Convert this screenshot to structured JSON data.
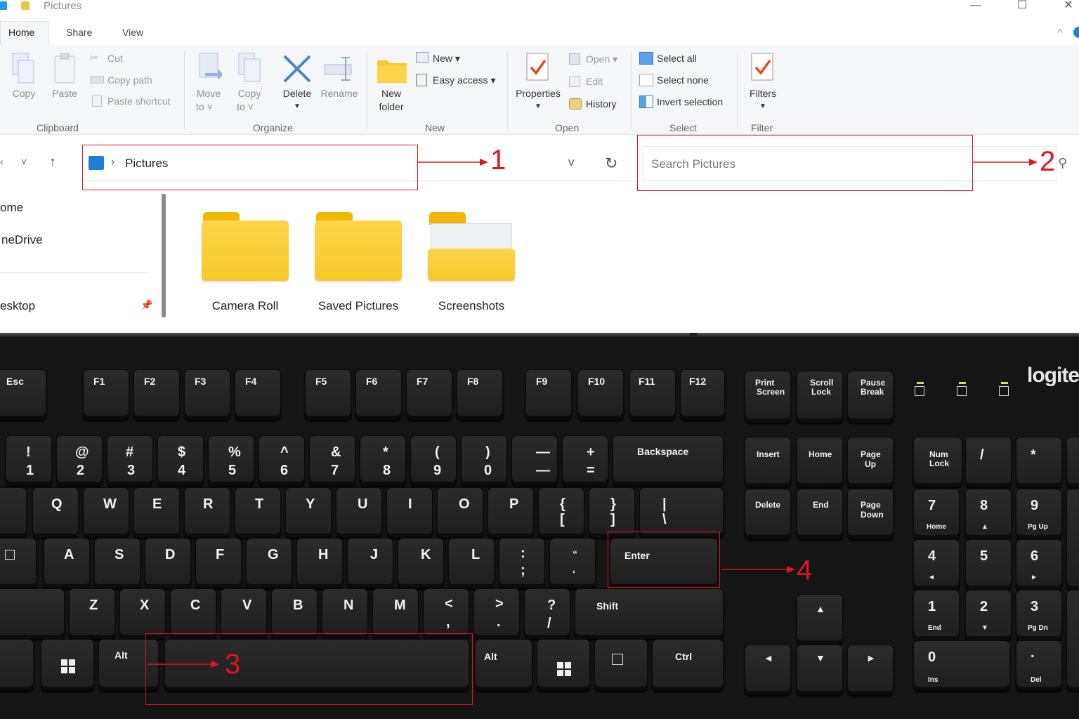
{
  "window": {
    "title": "Pictures",
    "minimize": "—",
    "maximize": "☐",
    "close": "✕"
  },
  "menu": {
    "tabs": [
      "Home",
      "Share",
      "View"
    ]
  },
  "ribbon": {
    "clipboard": {
      "copy": "Copy",
      "paste": "Paste",
      "cut": "Cut",
      "copy_path": "Copy path",
      "paste_shortcut": "Paste shortcut",
      "group": "Clipboard"
    },
    "organize": {
      "move_to_1": "Move",
      "move_to_2": "to ˅",
      "copy_to_1": "Copy",
      "copy_to_2": "to ˅",
      "delete": "Delete",
      "rename": "Rename",
      "group": "Organize"
    },
    "new": {
      "new_folder_1": "New",
      "new_folder_2": "folder",
      "new_item": "New ▾",
      "easy_access": "Easy access ▾",
      "group": "New"
    },
    "open": {
      "properties": "Properties",
      "open": "Open ▾",
      "edit": "Edit",
      "history": "History",
      "group": "Open"
    },
    "select": {
      "select_all": "Select all",
      "select_none": "Select none",
      "invert": "Invert selection",
      "group": "Select"
    },
    "filter": {
      "filters": "Filters",
      "group": "Filter"
    }
  },
  "address": {
    "crumb_sep": "›",
    "path": "Pictures",
    "search_placeholder": "Search Pictures"
  },
  "nav": {
    "items": [
      "ome",
      "neDrive",
      "esktop"
    ]
  },
  "folders": [
    {
      "name": "Camera Roll"
    },
    {
      "name": "Saved Pictures"
    },
    {
      "name": "Screenshots"
    }
  ],
  "annotations": [
    "1",
    "2",
    "3",
    "4"
  ],
  "keyboard": {
    "logo": "logite",
    "fn_row": [
      "Esc",
      "F1",
      "F2",
      "F3",
      "F4",
      "F5",
      "F6",
      "F7",
      "F8",
      "F9",
      "F10",
      "F11",
      "F12"
    ],
    "sys": {
      "print_1": "Print",
      "print_2": "Screen",
      "scroll_1": "Scroll",
      "scroll_2": "Lock",
      "pause_1": "Pause",
      "pause_2": "Break"
    },
    "num_row": [
      {
        "top": "!",
        "bottom": "1"
      },
      {
        "top": "@",
        "bottom": "2"
      },
      {
        "top": "#",
        "bottom": "3"
      },
      {
        "top": "$",
        "bottom": "4"
      },
      {
        "top": "%",
        "bottom": "5"
      },
      {
        "top": "^",
        "bottom": "6"
      },
      {
        "top": "&",
        "bottom": "7"
      },
      {
        "top": "*",
        "bottom": "8"
      },
      {
        "top": "(",
        "bottom": "9"
      },
      {
        "top": ")",
        "bottom": "0"
      },
      {
        "top": "—",
        "bottom": "—"
      },
      {
        "top": "+",
        "bottom": "="
      }
    ],
    "backspace": "Backspace",
    "qwerty": [
      "Q",
      "W",
      "E",
      "R",
      "T",
      "Y",
      "U",
      "I",
      "O",
      "P"
    ],
    "brackets": [
      {
        "top": "{",
        "bottom": "["
      },
      {
        "top": "}",
        "bottom": "]"
      },
      {
        "top": "|",
        "bottom": "\\"
      }
    ],
    "asdf": [
      "A",
      "S",
      "D",
      "F",
      "G",
      "H",
      "J",
      "K",
      "L"
    ],
    "semicolon": {
      "top": ":",
      "bottom": ";"
    },
    "quote": {
      "top": "“",
      "bottom": "‘"
    },
    "enter": "Enter",
    "zxcv": [
      "Z",
      "X",
      "C",
      "V",
      "B",
      "N",
      "M"
    ],
    "comma": {
      "top": "<",
      "bottom": ","
    },
    "period": {
      "top": ">",
      "bottom": "."
    },
    "slash": {
      "top": "?",
      "bottom": "/"
    },
    "shift": "Shift",
    "alt_left": "Alt",
    "alt_right": "Alt",
    "ctrl": "Ctrl",
    "nav_cluster": {
      "insert": "Insert",
      "home": "Home",
      "page_up_1": "Page",
      "page_up_2": "Up",
      "delete": "Delete",
      "end": "End",
      "page_down_1": "Page",
      "page_down_2": "Down"
    },
    "arrows": {
      "up": "▲",
      "left": "◄",
      "down": "▼",
      "right": "►"
    },
    "numpad": {
      "numlock_1": "Num",
      "numlock_2": "Lock",
      "slash": "/",
      "star": "*",
      "n7": "7",
      "n7s": "Home",
      "n8": "8",
      "n8s": "▲",
      "n9": "9",
      "n9s": "Pg Up",
      "n4": "4",
      "n4s": "◄",
      "n5": "5",
      "n6": "6",
      "n6s": "►",
      "n1": "1",
      "n1s": "End",
      "n2": "2",
      "n2s": "▼",
      "n3": "3",
      "n3s": "Pg Dn",
      "n0": "0",
      "n0s": "Ins",
      "dot": ".",
      "dots": "Del"
    }
  }
}
